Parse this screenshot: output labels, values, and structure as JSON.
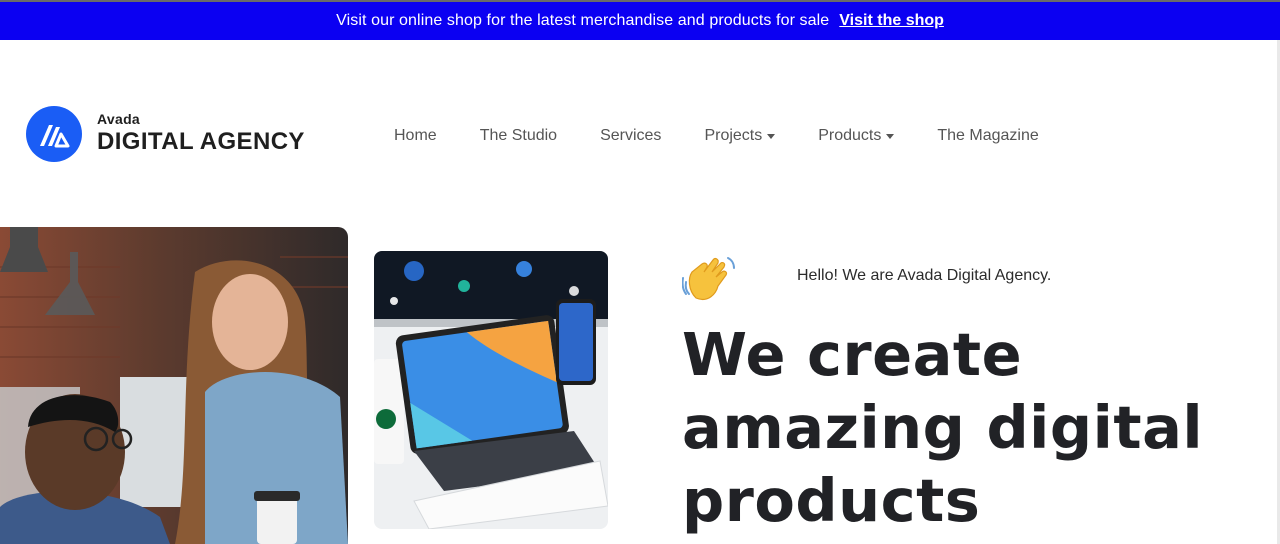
{
  "topbar": {
    "message": "Visit our online shop for the latest merchandise and products for sale",
    "link_label": "Visit the shop",
    "bg_color": "#0b00f2"
  },
  "logo": {
    "small_text": "Avada",
    "big_text": "DIGITAL AGENCY",
    "mark_color": "#1a5df5"
  },
  "nav": {
    "items": [
      {
        "label": "Home"
      },
      {
        "label": "The Studio"
      },
      {
        "label": "Services"
      },
      {
        "label": "Projects",
        "dropdown": true
      },
      {
        "label": "Products",
        "dropdown": true
      },
      {
        "label": "The Magazine"
      }
    ]
  },
  "hero": {
    "greeting_icon": "waving-hand-icon",
    "greeting": "Hello! We are Avada Digital Agency.",
    "headline": "We create amazing digital products",
    "image_left": "team-office-photo",
    "image_right": "devices-workspace-photo"
  }
}
